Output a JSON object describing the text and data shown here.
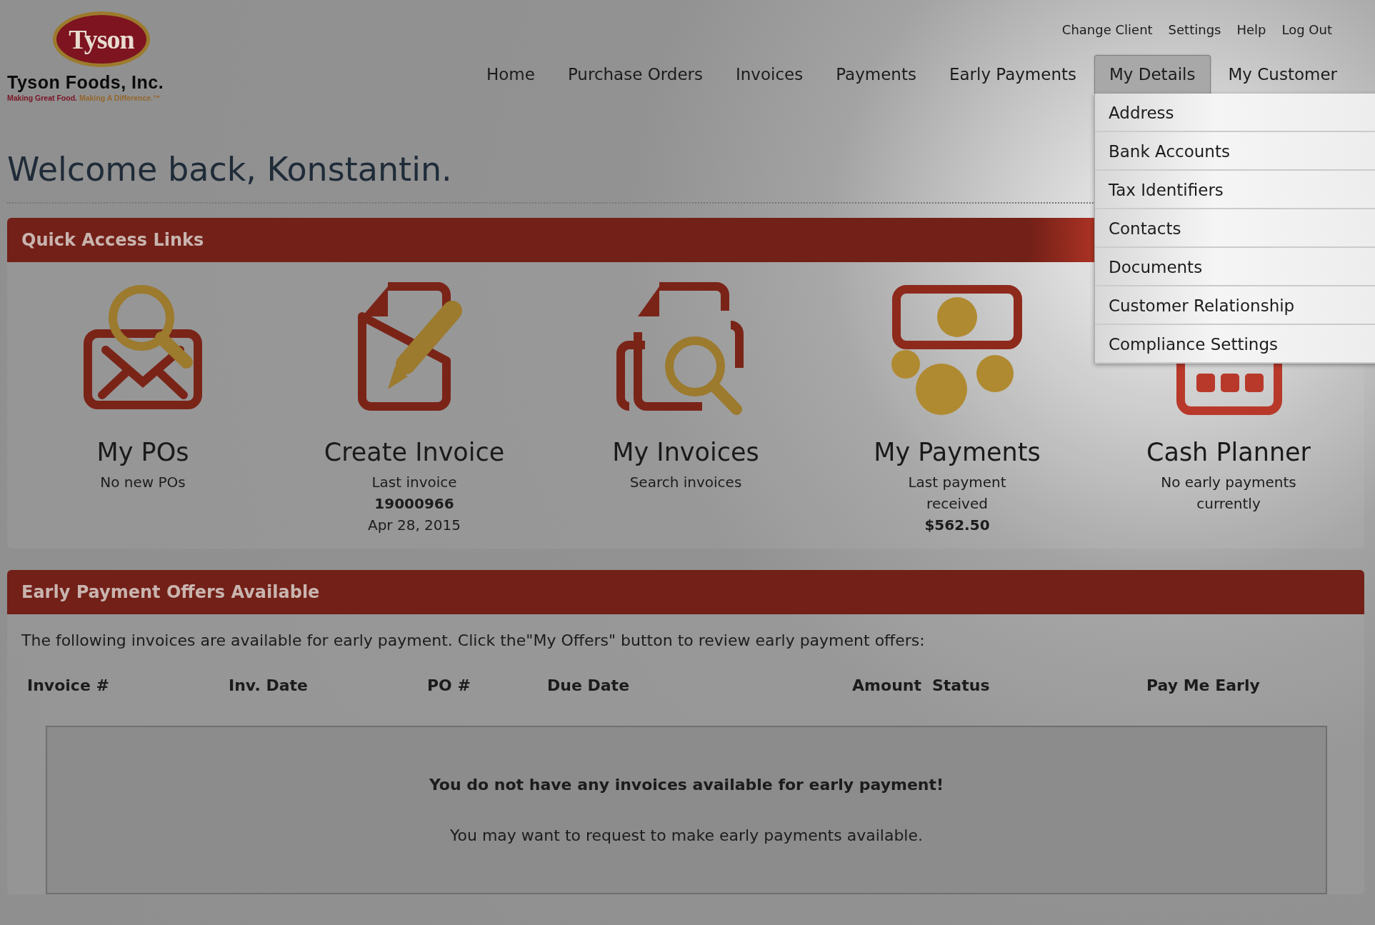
{
  "logo": {
    "badge": "Tyson",
    "company": "Tyson Foods, Inc.",
    "tagline_part_1": "Making Great Food.",
    "tagline_part_2": "Making A Difference.™"
  },
  "utility_links": [
    "Change Client",
    "Settings",
    "Help",
    "Log Out"
  ],
  "nav": [
    {
      "label": "Home",
      "selected": false
    },
    {
      "label": "Purchase Orders",
      "selected": false
    },
    {
      "label": "Invoices",
      "selected": false
    },
    {
      "label": "Payments",
      "selected": false
    },
    {
      "label": "Early Payments",
      "selected": false
    },
    {
      "label": "My Details",
      "selected": true,
      "dropdown": [
        "Address",
        "Bank Accounts",
        "Tax Identifiers",
        "Contacts",
        "Documents",
        "Customer Relationship",
        "Compliance Settings"
      ]
    },
    {
      "label": "My Customer",
      "selected": false
    }
  ],
  "welcome": "Welcome back, Konstantin.",
  "quick_access": {
    "title": "Quick Access Links",
    "tiles": [
      {
        "kind": "envelope-search",
        "title": "My POs",
        "lines": [
          {
            "text": "No new POs",
            "emphasis": false
          }
        ]
      },
      {
        "kind": "document-pencil",
        "title": "Create Invoice",
        "lines": [
          {
            "text": "Last invoice",
            "emphasis": false
          },
          {
            "text": "19000966",
            "emphasis": true
          },
          {
            "text": "Apr 28, 2015",
            "emphasis": false
          }
        ]
      },
      {
        "kind": "documents-search",
        "title": "My Invoices",
        "lines": [
          {
            "text": "Search invoices",
            "emphasis": false
          }
        ]
      },
      {
        "kind": "money-coins",
        "title": "My Payments",
        "lines": [
          {
            "text": "Last payment",
            "emphasis": false
          },
          {
            "text": "received",
            "emphasis": false
          },
          {
            "text": "$562.50",
            "emphasis": true
          }
        ]
      },
      {
        "kind": "calendar",
        "title": "Cash Planner",
        "lines": [
          {
            "text": "No early payments",
            "emphasis": false
          },
          {
            "text": "currently",
            "emphasis": false
          }
        ]
      }
    ]
  },
  "early_payments": {
    "title": "Early Payment Offers Available",
    "intro": "The following invoices are available for early payment. Click the\"My Offers\" button to review early payment offers:",
    "columns": [
      "Invoice #",
      "Inv. Date",
      "PO #",
      "Due Date",
      "Amount",
      "Status",
      "Pay Me Early"
    ],
    "empty_title": "You do not have any invoices available for early payment!",
    "empty_text": "You may want to request to make early payments available."
  }
}
